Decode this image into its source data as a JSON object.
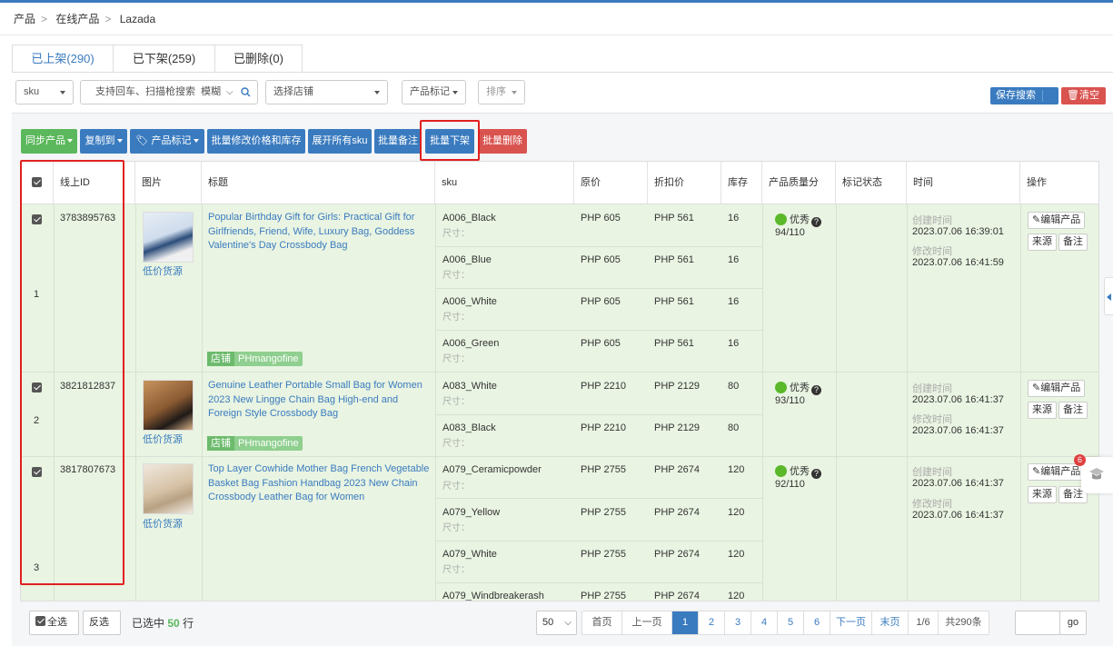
{
  "breadcrumb": [
    "产品",
    "在线产品",
    "Lazada"
  ],
  "tabs": [
    "已上架(290)",
    "已下架(259)",
    "已删除(0)"
  ],
  "filters": {
    "sku": "sku",
    "search_placeholder": "支持回车、扫描枪搜索",
    "search_mode": "模糊",
    "store": "选择店铺",
    "tag": "产品标记",
    "sort": "排序"
  },
  "top_buttons": {
    "save_search": "保存搜索",
    "clear": "清空"
  },
  "actions": [
    "同步产品",
    "复制到",
    "产品标记",
    "批量修改价格和库存",
    "展开所有sku",
    "批量备注",
    "批量下架",
    "批量删除"
  ],
  "columns": [
    "线上ID",
    "图片",
    "标题",
    "sku",
    "原价",
    "折扣价",
    "库存",
    "产品质量分",
    "标记状态",
    "时间",
    "操作"
  ],
  "rows": [
    {
      "index": "1",
      "id": "3783895763",
      "source_link": "低价货源",
      "title": "Popular Birthday Gift for Girls: Practical Gift for Girlfriends, Friend, Wife, Luxury Bag, Goddess Valentine's Day Crossbody Bag",
      "store_label": "店铺",
      "store": "PHmangofine",
      "skus": [
        {
          "sku": "A006_Black",
          "size": "尺寸：",
          "price": "PHP 605",
          "discount": "PHP 561",
          "stock": "16"
        },
        {
          "sku": "A006_Blue",
          "size": "尺寸：",
          "price": "PHP 605",
          "discount": "PHP 561",
          "stock": "16"
        },
        {
          "sku": "A006_White",
          "size": "尺寸：",
          "price": "PHP 605",
          "discount": "PHP 561",
          "stock": "16"
        },
        {
          "sku": "A006_Green",
          "size": "尺寸：",
          "price": "PHP 605",
          "discount": "PHP 561",
          "stock": "16"
        }
      ],
      "quality": "优秀",
      "score": "94/110",
      "created_label": "创建时间",
      "created": "2023.07.06 16:39:01",
      "modified_label": "修改时间",
      "modified": "2023.07.06 16:41:59"
    },
    {
      "index": "2",
      "id": "3821812837",
      "source_link": "低价货源",
      "title": "Genuine Leather Portable Small Bag for Women 2023 New Lingge Chain Bag High-end and Foreign Style Crossbody Bag",
      "store_label": "店铺",
      "store": "PHmangofine",
      "skus": [
        {
          "sku": "A083_White",
          "size": "尺寸：",
          "price": "PHP 2210",
          "discount": "PHP 2129",
          "stock": "80"
        },
        {
          "sku": "A083_Black",
          "size": "尺寸：",
          "price": "PHP 2210",
          "discount": "PHP 2129",
          "stock": "80"
        }
      ],
      "quality": "优秀",
      "score": "93/110",
      "created_label": "创建时间",
      "created": "2023.07.06 16:41:37",
      "modified_label": "修改时间",
      "modified": "2023.07.06 16:41:37"
    },
    {
      "index": "3",
      "id": "3817807673",
      "source_link": "低价货源",
      "title": "Top Layer Cowhide Mother Bag French Vegetable Basket Bag Fashion Handbag 2023 New Chain Crossbody Leather Bag for Women",
      "skus": [
        {
          "sku": "A079_Ceramicpowder",
          "size": "尺寸：",
          "price": "PHP 2755",
          "discount": "PHP 2674",
          "stock": "120"
        },
        {
          "sku": "A079_Yellow",
          "size": "尺寸：",
          "price": "PHP 2755",
          "discount": "PHP 2674",
          "stock": "120"
        },
        {
          "sku": "A079_White",
          "size": "尺寸：",
          "price": "PHP 2755",
          "discount": "PHP 2674",
          "stock": "120"
        },
        {
          "sku": "A079_Windbreakerash",
          "size": "",
          "price": "PHP 2755",
          "discount": "PHP 2674",
          "stock": "120"
        }
      ],
      "quality": "优秀",
      "score": "92/110",
      "created_label": "创建时间",
      "created": "2023.07.06 16:41:37",
      "modified_label": "修改时间",
      "modified": "2023.07.06 16:41:37"
    }
  ],
  "row_ops": {
    "edit": "编辑产品",
    "source": "来源",
    "note": "备注"
  },
  "footer": {
    "select_all": "全选",
    "invert": "反选",
    "selected_prefix": "已选中",
    "selected_count": "50",
    "selected_suffix": "行",
    "page_size": "50",
    "pager": [
      "首页",
      "上一页",
      "1",
      "2",
      "3",
      "4",
      "5",
      "6",
      "下一页",
      "末页",
      "1/6",
      "共290条"
    ],
    "go": "go"
  },
  "float_badge": "6",
  "colors": {
    "accent": "#3a7bbf",
    "success": "#5cb85c",
    "danger": "#d9534f",
    "row_bg": "#e9f4e2",
    "highlight": "#e02020"
  }
}
